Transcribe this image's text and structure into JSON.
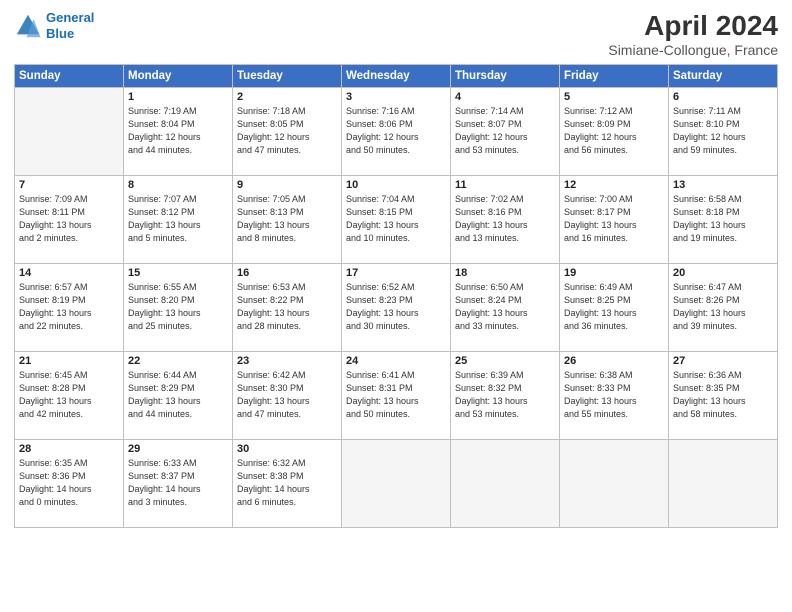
{
  "header": {
    "logo_line1": "General",
    "logo_line2": "Blue",
    "title": "April 2024",
    "subtitle": "Simiane-Collongue, France"
  },
  "weekdays": [
    "Sunday",
    "Monday",
    "Tuesday",
    "Wednesday",
    "Thursday",
    "Friday",
    "Saturday"
  ],
  "weeks": [
    [
      {
        "day": "",
        "info": ""
      },
      {
        "day": "1",
        "info": "Sunrise: 7:19 AM\nSunset: 8:04 PM\nDaylight: 12 hours\nand 44 minutes."
      },
      {
        "day": "2",
        "info": "Sunrise: 7:18 AM\nSunset: 8:05 PM\nDaylight: 12 hours\nand 47 minutes."
      },
      {
        "day": "3",
        "info": "Sunrise: 7:16 AM\nSunset: 8:06 PM\nDaylight: 12 hours\nand 50 minutes."
      },
      {
        "day": "4",
        "info": "Sunrise: 7:14 AM\nSunset: 8:07 PM\nDaylight: 12 hours\nand 53 minutes."
      },
      {
        "day": "5",
        "info": "Sunrise: 7:12 AM\nSunset: 8:09 PM\nDaylight: 12 hours\nand 56 minutes."
      },
      {
        "day": "6",
        "info": "Sunrise: 7:11 AM\nSunset: 8:10 PM\nDaylight: 12 hours\nand 59 minutes."
      }
    ],
    [
      {
        "day": "7",
        "info": "Sunrise: 7:09 AM\nSunset: 8:11 PM\nDaylight: 13 hours\nand 2 minutes."
      },
      {
        "day": "8",
        "info": "Sunrise: 7:07 AM\nSunset: 8:12 PM\nDaylight: 13 hours\nand 5 minutes."
      },
      {
        "day": "9",
        "info": "Sunrise: 7:05 AM\nSunset: 8:13 PM\nDaylight: 13 hours\nand 8 minutes."
      },
      {
        "day": "10",
        "info": "Sunrise: 7:04 AM\nSunset: 8:15 PM\nDaylight: 13 hours\nand 10 minutes."
      },
      {
        "day": "11",
        "info": "Sunrise: 7:02 AM\nSunset: 8:16 PM\nDaylight: 13 hours\nand 13 minutes."
      },
      {
        "day": "12",
        "info": "Sunrise: 7:00 AM\nSunset: 8:17 PM\nDaylight: 13 hours\nand 16 minutes."
      },
      {
        "day": "13",
        "info": "Sunrise: 6:58 AM\nSunset: 8:18 PM\nDaylight: 13 hours\nand 19 minutes."
      }
    ],
    [
      {
        "day": "14",
        "info": "Sunrise: 6:57 AM\nSunset: 8:19 PM\nDaylight: 13 hours\nand 22 minutes."
      },
      {
        "day": "15",
        "info": "Sunrise: 6:55 AM\nSunset: 8:20 PM\nDaylight: 13 hours\nand 25 minutes."
      },
      {
        "day": "16",
        "info": "Sunrise: 6:53 AM\nSunset: 8:22 PM\nDaylight: 13 hours\nand 28 minutes."
      },
      {
        "day": "17",
        "info": "Sunrise: 6:52 AM\nSunset: 8:23 PM\nDaylight: 13 hours\nand 30 minutes."
      },
      {
        "day": "18",
        "info": "Sunrise: 6:50 AM\nSunset: 8:24 PM\nDaylight: 13 hours\nand 33 minutes."
      },
      {
        "day": "19",
        "info": "Sunrise: 6:49 AM\nSunset: 8:25 PM\nDaylight: 13 hours\nand 36 minutes."
      },
      {
        "day": "20",
        "info": "Sunrise: 6:47 AM\nSunset: 8:26 PM\nDaylight: 13 hours\nand 39 minutes."
      }
    ],
    [
      {
        "day": "21",
        "info": "Sunrise: 6:45 AM\nSunset: 8:28 PM\nDaylight: 13 hours\nand 42 minutes."
      },
      {
        "day": "22",
        "info": "Sunrise: 6:44 AM\nSunset: 8:29 PM\nDaylight: 13 hours\nand 44 minutes."
      },
      {
        "day": "23",
        "info": "Sunrise: 6:42 AM\nSunset: 8:30 PM\nDaylight: 13 hours\nand 47 minutes."
      },
      {
        "day": "24",
        "info": "Sunrise: 6:41 AM\nSunset: 8:31 PM\nDaylight: 13 hours\nand 50 minutes."
      },
      {
        "day": "25",
        "info": "Sunrise: 6:39 AM\nSunset: 8:32 PM\nDaylight: 13 hours\nand 53 minutes."
      },
      {
        "day": "26",
        "info": "Sunrise: 6:38 AM\nSunset: 8:33 PM\nDaylight: 13 hours\nand 55 minutes."
      },
      {
        "day": "27",
        "info": "Sunrise: 6:36 AM\nSunset: 8:35 PM\nDaylight: 13 hours\nand 58 minutes."
      }
    ],
    [
      {
        "day": "28",
        "info": "Sunrise: 6:35 AM\nSunset: 8:36 PM\nDaylight: 14 hours\nand 0 minutes."
      },
      {
        "day": "29",
        "info": "Sunrise: 6:33 AM\nSunset: 8:37 PM\nDaylight: 14 hours\nand 3 minutes."
      },
      {
        "day": "30",
        "info": "Sunrise: 6:32 AM\nSunset: 8:38 PM\nDaylight: 14 hours\nand 6 minutes."
      },
      {
        "day": "",
        "info": ""
      },
      {
        "day": "",
        "info": ""
      },
      {
        "day": "",
        "info": ""
      },
      {
        "day": "",
        "info": ""
      }
    ]
  ]
}
